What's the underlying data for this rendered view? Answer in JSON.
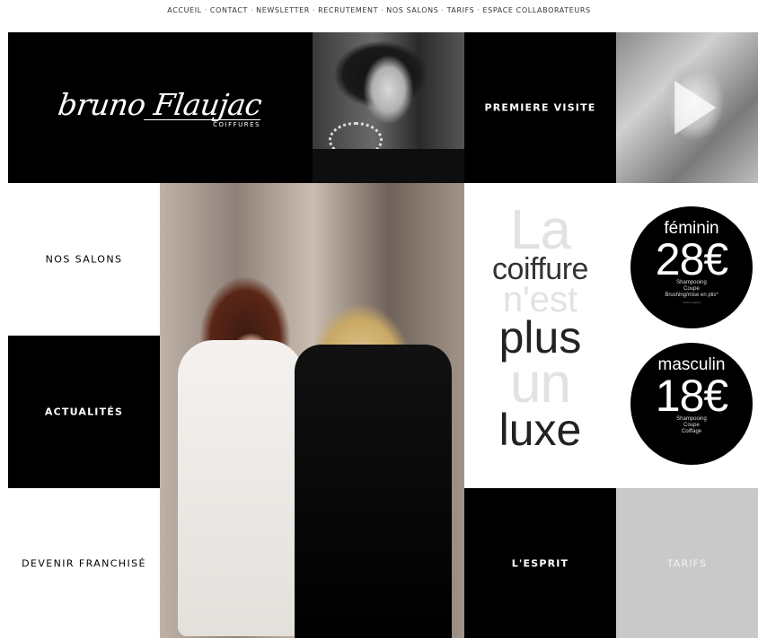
{
  "nav": {
    "items": [
      "ACCUEIL",
      "CONTACT",
      "NEWSLETTER",
      "RECRUTEMENT",
      "NOS SALONS",
      "TARIFS",
      "ESPACE COLLABORATEURS"
    ],
    "separator": "·"
  },
  "logo": {
    "script": "bruno Flaujac",
    "sub": "COIFFURES"
  },
  "tiles": {
    "premiere_visite": "PREMIERE VISITE",
    "nos_salons": "NOS SALONS",
    "actualites": "ACTUALITÉS",
    "devenir_franchise": "DEVENIR FRANCHISÉ",
    "esprit": "L'ESPRIT",
    "tarifs": "TARIFS"
  },
  "slogan": {
    "line1": "La",
    "line2": "coiffure",
    "line3": "n'est",
    "line4": "plus",
    "line5": "un",
    "line6": "luxe"
  },
  "prices": {
    "feminin": {
      "title": "féminin",
      "price": "28€",
      "details": [
        "Shampooing",
        "Coupe",
        "Brushing/mise en plis*"
      ],
      "fine": "*selon longueur"
    },
    "masculin": {
      "title": "masculin",
      "price": "18€",
      "details": [
        "Shampooing",
        "Coupe",
        "Coiffage"
      ]
    }
  },
  "icons": {
    "video_play": "play-icon"
  },
  "colors": {
    "black": "#000000",
    "white": "#ffffff",
    "grey_tile": "#c9c9c9",
    "slogan_light": "#e2e2e2",
    "slogan_dark": "#222222"
  }
}
